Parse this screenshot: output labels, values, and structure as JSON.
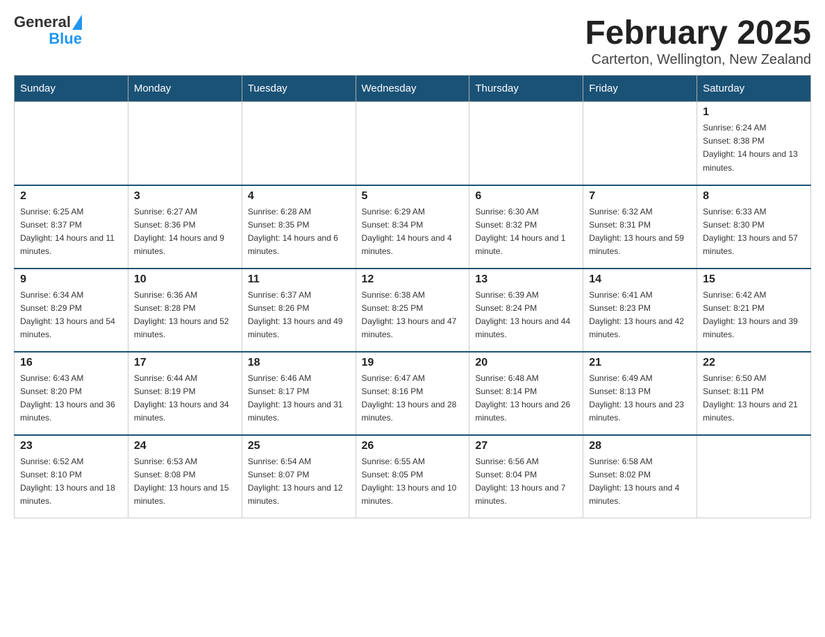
{
  "logo": {
    "general": "General",
    "blue": "Blue"
  },
  "title": "February 2025",
  "subtitle": "Carterton, Wellington, New Zealand",
  "weekdays": [
    "Sunday",
    "Monday",
    "Tuesday",
    "Wednesday",
    "Thursday",
    "Friday",
    "Saturday"
  ],
  "weeks": [
    [
      {
        "day": "",
        "info": ""
      },
      {
        "day": "",
        "info": ""
      },
      {
        "day": "",
        "info": ""
      },
      {
        "day": "",
        "info": ""
      },
      {
        "day": "",
        "info": ""
      },
      {
        "day": "",
        "info": ""
      },
      {
        "day": "1",
        "info": "Sunrise: 6:24 AM\nSunset: 8:38 PM\nDaylight: 14 hours and 13 minutes."
      }
    ],
    [
      {
        "day": "2",
        "info": "Sunrise: 6:25 AM\nSunset: 8:37 PM\nDaylight: 14 hours and 11 minutes."
      },
      {
        "day": "3",
        "info": "Sunrise: 6:27 AM\nSunset: 8:36 PM\nDaylight: 14 hours and 9 minutes."
      },
      {
        "day": "4",
        "info": "Sunrise: 6:28 AM\nSunset: 8:35 PM\nDaylight: 14 hours and 6 minutes."
      },
      {
        "day": "5",
        "info": "Sunrise: 6:29 AM\nSunset: 8:34 PM\nDaylight: 14 hours and 4 minutes."
      },
      {
        "day": "6",
        "info": "Sunrise: 6:30 AM\nSunset: 8:32 PM\nDaylight: 14 hours and 1 minute."
      },
      {
        "day": "7",
        "info": "Sunrise: 6:32 AM\nSunset: 8:31 PM\nDaylight: 13 hours and 59 minutes."
      },
      {
        "day": "8",
        "info": "Sunrise: 6:33 AM\nSunset: 8:30 PM\nDaylight: 13 hours and 57 minutes."
      }
    ],
    [
      {
        "day": "9",
        "info": "Sunrise: 6:34 AM\nSunset: 8:29 PM\nDaylight: 13 hours and 54 minutes."
      },
      {
        "day": "10",
        "info": "Sunrise: 6:36 AM\nSunset: 8:28 PM\nDaylight: 13 hours and 52 minutes."
      },
      {
        "day": "11",
        "info": "Sunrise: 6:37 AM\nSunset: 8:26 PM\nDaylight: 13 hours and 49 minutes."
      },
      {
        "day": "12",
        "info": "Sunrise: 6:38 AM\nSunset: 8:25 PM\nDaylight: 13 hours and 47 minutes."
      },
      {
        "day": "13",
        "info": "Sunrise: 6:39 AM\nSunset: 8:24 PM\nDaylight: 13 hours and 44 minutes."
      },
      {
        "day": "14",
        "info": "Sunrise: 6:41 AM\nSunset: 8:23 PM\nDaylight: 13 hours and 42 minutes."
      },
      {
        "day": "15",
        "info": "Sunrise: 6:42 AM\nSunset: 8:21 PM\nDaylight: 13 hours and 39 minutes."
      }
    ],
    [
      {
        "day": "16",
        "info": "Sunrise: 6:43 AM\nSunset: 8:20 PM\nDaylight: 13 hours and 36 minutes."
      },
      {
        "day": "17",
        "info": "Sunrise: 6:44 AM\nSunset: 8:19 PM\nDaylight: 13 hours and 34 minutes."
      },
      {
        "day": "18",
        "info": "Sunrise: 6:46 AM\nSunset: 8:17 PM\nDaylight: 13 hours and 31 minutes."
      },
      {
        "day": "19",
        "info": "Sunrise: 6:47 AM\nSunset: 8:16 PM\nDaylight: 13 hours and 28 minutes."
      },
      {
        "day": "20",
        "info": "Sunrise: 6:48 AM\nSunset: 8:14 PM\nDaylight: 13 hours and 26 minutes."
      },
      {
        "day": "21",
        "info": "Sunrise: 6:49 AM\nSunset: 8:13 PM\nDaylight: 13 hours and 23 minutes."
      },
      {
        "day": "22",
        "info": "Sunrise: 6:50 AM\nSunset: 8:11 PM\nDaylight: 13 hours and 21 minutes."
      }
    ],
    [
      {
        "day": "23",
        "info": "Sunrise: 6:52 AM\nSunset: 8:10 PM\nDaylight: 13 hours and 18 minutes."
      },
      {
        "day": "24",
        "info": "Sunrise: 6:53 AM\nSunset: 8:08 PM\nDaylight: 13 hours and 15 minutes."
      },
      {
        "day": "25",
        "info": "Sunrise: 6:54 AM\nSunset: 8:07 PM\nDaylight: 13 hours and 12 minutes."
      },
      {
        "day": "26",
        "info": "Sunrise: 6:55 AM\nSunset: 8:05 PM\nDaylight: 13 hours and 10 minutes."
      },
      {
        "day": "27",
        "info": "Sunrise: 6:56 AM\nSunset: 8:04 PM\nDaylight: 13 hours and 7 minutes."
      },
      {
        "day": "28",
        "info": "Sunrise: 6:58 AM\nSunset: 8:02 PM\nDaylight: 13 hours and 4 minutes."
      },
      {
        "day": "",
        "info": ""
      }
    ]
  ]
}
